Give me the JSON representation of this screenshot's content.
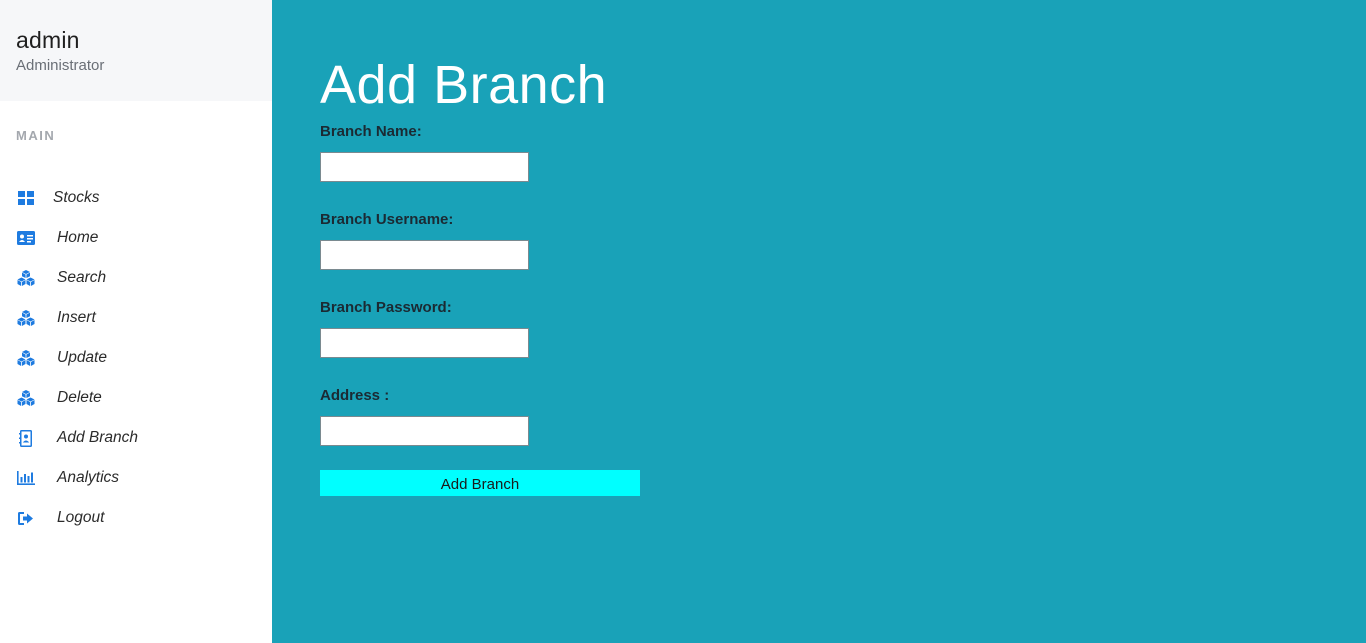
{
  "user": {
    "name": "admin",
    "role": "Administrator"
  },
  "sidebar": {
    "section_label": "MAIN",
    "items": [
      {
        "label": "Stocks",
        "icon": "grid-icon"
      },
      {
        "label": "Home",
        "icon": "id-card-icon"
      },
      {
        "label": "Search",
        "icon": "cubes-icon"
      },
      {
        "label": "Insert",
        "icon": "cubes-icon"
      },
      {
        "label": "Update",
        "icon": "cubes-icon"
      },
      {
        "label": "Delete",
        "icon": "cubes-icon"
      },
      {
        "label": "Add Branch",
        "icon": "address-book-icon"
      },
      {
        "label": "Analytics",
        "icon": "bar-chart-icon"
      },
      {
        "label": "Logout",
        "icon": "sign-out-icon"
      }
    ]
  },
  "main": {
    "title": "Add Branch",
    "form": {
      "branch_name_label": "Branch Name:",
      "branch_name_value": "",
      "branch_username_label": "Branch Username:",
      "branch_username_value": "",
      "branch_password_label": "Branch Password:",
      "branch_password_value": "",
      "address_label": "Address :",
      "address_value": "",
      "submit_label": "Add Branch"
    }
  },
  "colors": {
    "sidebar_bg": "#ffffff",
    "user_box_bg": "#f6f7f9",
    "main_bg": "#19a2b8",
    "icon_blue": "#1e7be0",
    "button_bg": "#00ffff"
  }
}
